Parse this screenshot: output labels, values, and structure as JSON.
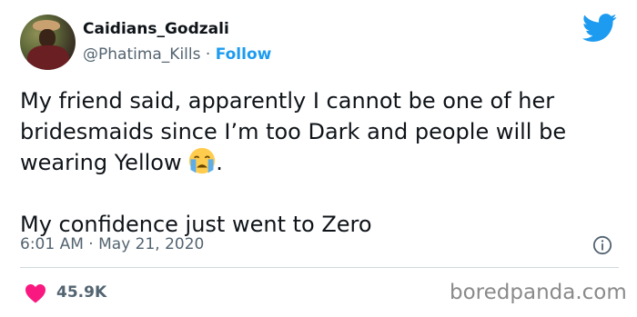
{
  "author": {
    "display_name": "Caidians_Godzali",
    "handle": "@Phatima_Kills",
    "separator": "·",
    "follow_label": "Follow"
  },
  "tweet": {
    "line1": "My friend said, apparently I cannot be one of her bridesmaids since I’m too Dark and people will be wearing Yellow",
    "emoji": "loudly-crying-face",
    "line1_end": ".",
    "line2": "My confidence just went to Zero"
  },
  "meta": {
    "time": "6:01 AM",
    "separator": "·",
    "date": "May 21, 2020"
  },
  "engagement": {
    "likes": "45.9K"
  },
  "watermark": "boredpanda.com",
  "colors": {
    "twitter_blue": "#1d9bf0",
    "heart": "#f91880",
    "muted": "#536471"
  }
}
